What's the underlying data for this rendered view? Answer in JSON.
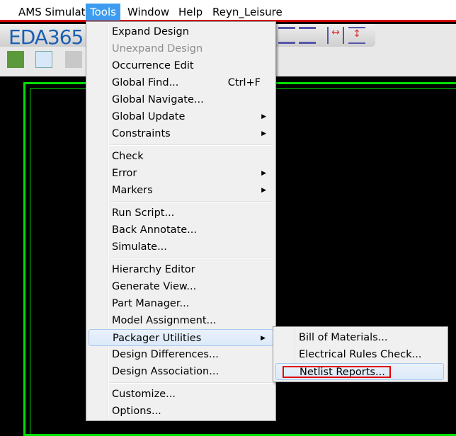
{
  "menubar": {
    "items": [
      "AMS Simulator",
      "Tools",
      "Window",
      "Help",
      "Reyn_Leisure"
    ],
    "active": "Tools"
  },
  "logo": "EDA365",
  "tools_menu": {
    "groups": [
      [
        {
          "label": "Expand Design"
        },
        {
          "label": "Unexpand Design",
          "disabled": true
        },
        {
          "label": "Occurrence Edit"
        },
        {
          "label": "Global Find...",
          "shortcut": "Ctrl+F"
        },
        {
          "label": "Global Navigate..."
        },
        {
          "label": "Global Update",
          "submenu": true
        },
        {
          "label": "Constraints",
          "submenu": true
        }
      ],
      [
        {
          "label": "Check"
        },
        {
          "label": "Error",
          "submenu": true
        },
        {
          "label": "Markers",
          "submenu": true
        }
      ],
      [
        {
          "label": "Run Script..."
        },
        {
          "label": "Back Annotate..."
        },
        {
          "label": "Simulate..."
        }
      ],
      [
        {
          "label": "Hierarchy Editor"
        },
        {
          "label": "Generate View..."
        },
        {
          "label": "Part Manager..."
        },
        {
          "label": "Model Assignment..."
        },
        {
          "label": "Packager Utilities",
          "submenu": true,
          "highlighted": true
        },
        {
          "label": "Design Differences..."
        },
        {
          "label": "Design Association..."
        }
      ],
      [
        {
          "label": "Customize..."
        },
        {
          "label": "Options..."
        }
      ]
    ]
  },
  "packager_submenu": {
    "items": [
      {
        "label": "Bill of Materials..."
      },
      {
        "label": "Electrical Rules Check..."
      },
      {
        "label": "Netlist Reports...",
        "highlighted": true
      }
    ]
  },
  "colors": {
    "menu_highlight": "#3d9cf0",
    "annotation_box": "#e00000",
    "schematic_border": "#00e000"
  }
}
